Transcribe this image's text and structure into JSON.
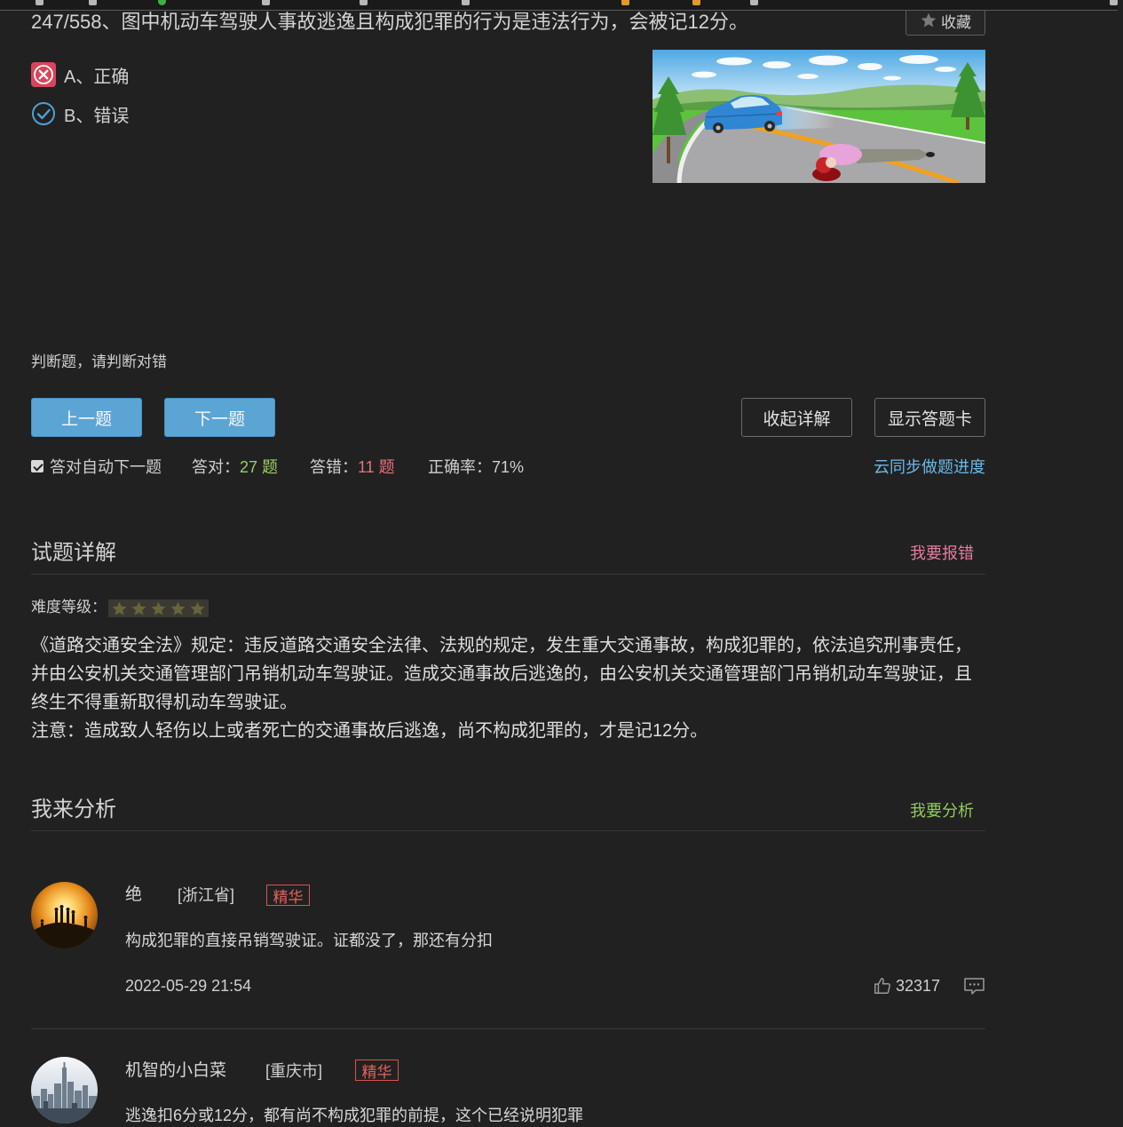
{
  "colors": {
    "background": "#212121",
    "primary_button": "#5ba5d4",
    "correct_count": "#9ccc65",
    "wrong_count": "#e8707a",
    "link_blue": "#6db8e6",
    "report_pink": "#e27ca0",
    "analyze_green": "#93c95c",
    "badge_red": "#d9534f"
  },
  "question": {
    "title": "247/558、图中机动车驾驶人事故逃逸且构成犯罪的行为是违法行为，会被记12分。",
    "favorite_label": "收藏",
    "favorite_icon": "star-icon",
    "options": [
      {
        "label": "A、正确",
        "icon": "wrong-mark-icon"
      },
      {
        "label": "B、错误",
        "icon": "check-circle-icon"
      }
    ],
    "type_hint": "判断题，请判断对错"
  },
  "nav": {
    "prev_label": "上一题",
    "next_label": "下一题",
    "collapse_label": "收起详解",
    "answer_card_label": "显示答题卡"
  },
  "stats": {
    "auto_next_checked": true,
    "auto_next_label": "答对自动下一题",
    "correct_label": "答对：",
    "correct_value": "27 题",
    "wrong_label": "答错：",
    "wrong_value": "11 题",
    "accuracy_label": "正确率：",
    "accuracy_value": "71%",
    "sync_label": "云同步做题进度"
  },
  "explanation": {
    "heading": "试题详解",
    "report_label": "我要报错",
    "difficulty_label": "难度等级：",
    "difficulty_stars": 5,
    "difficulty_max": 5,
    "paragraphs": [
      "《道路交通安全法》规定：违反道路交通安全法律、法规的规定，发生重大交通事故，构成犯罪的，依法追究刑事责任，并由公安机关交通管理部门吊销机动车驾驶证。造成交通事故后逃逸的，由公安机关交通管理部门吊销机动车驾驶证，且终生不得重新取得机动车驾驶证。",
      "注意：造成致人轻伤以上或者死亡的交通事故后逃逸，尚不构成犯罪的，才是记12分。"
    ]
  },
  "analysis": {
    "heading": "我来分析",
    "action_label": "我要分析",
    "comments": [
      {
        "user": "绝",
        "region": "[浙江省]",
        "badge": "精华",
        "text": "构成犯罪的直接吊销驾驶证。证都没了，那还有分扣",
        "time": "2022-05-29 21:54",
        "likes": "32317",
        "like_icon": "thumb-up-icon",
        "reply_icon": "comment-icon"
      },
      {
        "user": "机智的小白菜",
        "region": "[重庆市]",
        "badge": "精华",
        "text": "逃逸扣6分或12分，都有尚不构成犯罪的前提，这个已经说明犯罪"
      }
    ]
  }
}
